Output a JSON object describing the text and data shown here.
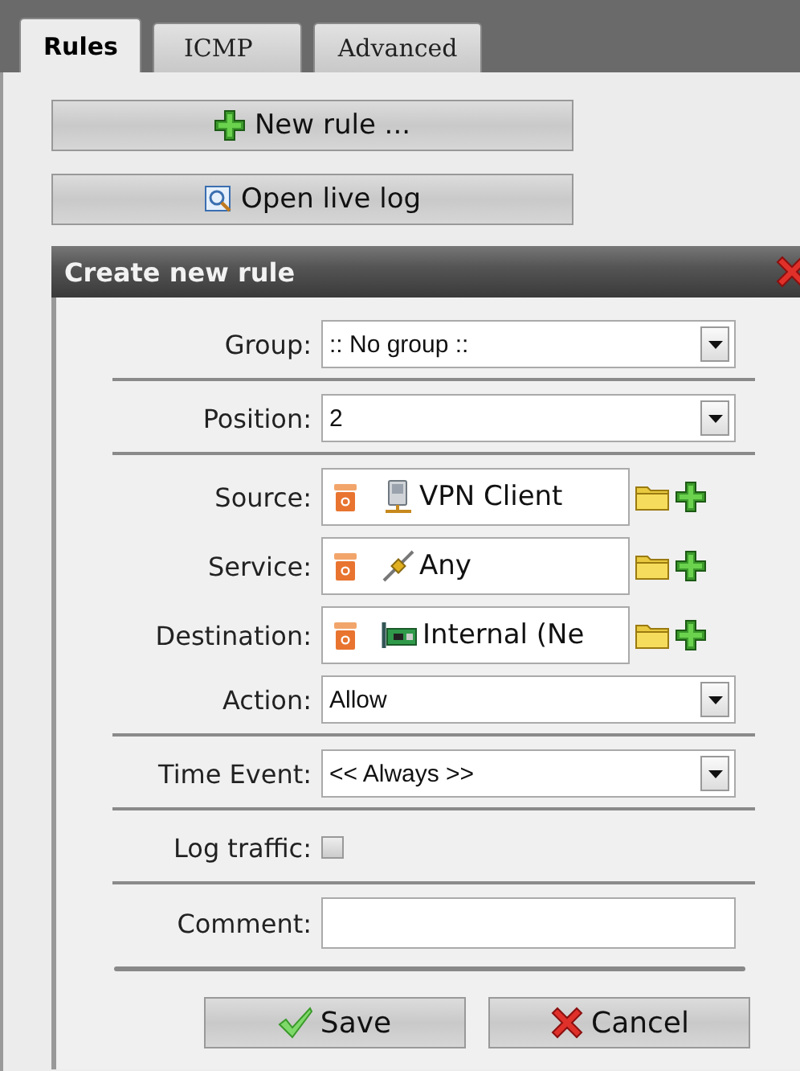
{
  "tabs": [
    {
      "label": "Rules",
      "selected": true
    },
    {
      "label": "ICMP",
      "selected": false
    },
    {
      "label": "Advanced",
      "selected": false
    }
  ],
  "actions": [
    {
      "label": "New rule ...",
      "kind": "add"
    },
    {
      "label": "Open live log",
      "kind": "log"
    }
  ],
  "dialog": {
    "title": "Create new rule",
    "fields": [
      {
        "kind": "select",
        "label": "Group:",
        "value": ":: No group ::"
      },
      {
        "kind": "select",
        "label": "Position:",
        "value": "2"
      },
      {
        "kind": "object",
        "label": "Source:",
        "value": "VPN Client"
      },
      {
        "kind": "object",
        "label": "Service:",
        "value": "Any"
      },
      {
        "kind": "object",
        "label": "Destination:",
        "value": "Internal (Ne"
      },
      {
        "kind": "select",
        "label": "Action:",
        "value": "Allow"
      },
      {
        "kind": "select",
        "label": "Time Event:",
        "value": "<< Always >>"
      },
      {
        "kind": "checkbox",
        "label": "Log traffic:",
        "checked": false
      },
      {
        "kind": "text",
        "label": "Comment:"
      }
    ],
    "buttons": [
      {
        "label": "Save",
        "kind": "save"
      },
      {
        "label": "Cancel",
        "kind": "cancel"
      }
    ]
  }
}
